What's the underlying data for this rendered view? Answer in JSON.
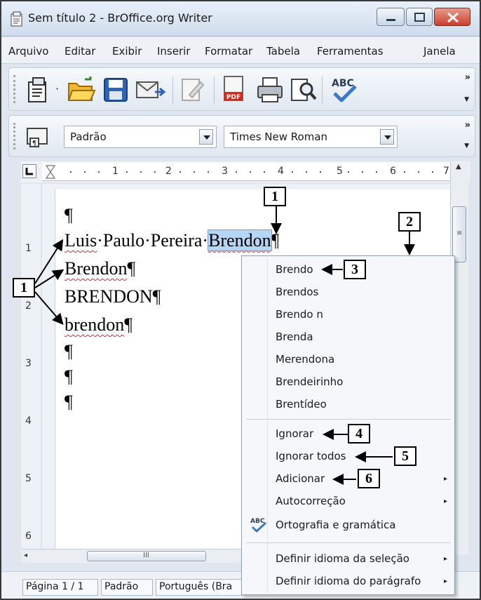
{
  "window": {
    "title": "Sem título 2 - BrOffice.org Writer"
  },
  "menubar": {
    "items": [
      "Arquivo",
      "Editar",
      "Exibir",
      "Inserir",
      "Formatar",
      "Tabela",
      "Ferramentas",
      "Janela"
    ]
  },
  "toolbar": {
    "more": "»",
    "style_value": "Padrão",
    "font_value": "Times New Roman",
    "icons": [
      "new-document-icon",
      "dropdown-arrow-icon",
      "open-folder-icon",
      "save-icon",
      "email-icon",
      "edit-file-icon",
      "export-pdf-icon",
      "print-icon",
      "page-preview-icon",
      "spellcheck-icon",
      "styles-icon"
    ]
  },
  "ruler": {
    "numbers": [
      "1",
      "2",
      "3",
      "4",
      "5",
      "6",
      "7"
    ]
  },
  "document": {
    "lines": [
      {
        "prefix": "",
        "word": "¶",
        "suffix": ""
      },
      {
        "prefix": "",
        "word": "Luis",
        "suffix": "·Paulo·Pereira·"
      },
      {
        "prefix": "",
        "word": "Brendon",
        "suffix": "¶"
      },
      {
        "prefix": "",
        "word": "BRENDON",
        "suffix": "¶"
      },
      {
        "prefix": "",
        "word": "brendon",
        "suffix": "¶"
      },
      {
        "prefix": "",
        "word": "¶",
        "suffix": ""
      },
      {
        "prefix": "",
        "word": "¶",
        "suffix": ""
      },
      {
        "prefix": "",
        "word": "¶",
        "suffix": ""
      }
    ],
    "selected_word": "Brendon",
    "selected_suffix": "¶"
  },
  "vertical_ruler": {
    "numbers": [
      "1",
      "2",
      "3",
      "4",
      "5",
      "6"
    ]
  },
  "context_menu": {
    "suggestions": [
      "Brendo",
      "Brendos",
      "Brendo n",
      "Brenda",
      "Merendona",
      "Brendeirinho",
      "Brentídeo"
    ],
    "ignore": "Ignorar",
    "ignore_all": "Ignorar todos",
    "add": "Adicionar",
    "autocorrect": "Autocorreção",
    "spelling": "Ortografia e gramática",
    "set_language_selection": "Definir idioma da seleção",
    "set_language_paragraph": "Definir idioma do parágrafo",
    "submenu_arrow": "▸"
  },
  "statusbar": {
    "page": "Página 1 / 1",
    "style": "Padrão",
    "language": "Português (Bra"
  },
  "hscroll": {
    "grip": "III"
  },
  "callouts": [
    "1",
    "1",
    "2",
    "3",
    "4",
    "5",
    "6"
  ]
}
